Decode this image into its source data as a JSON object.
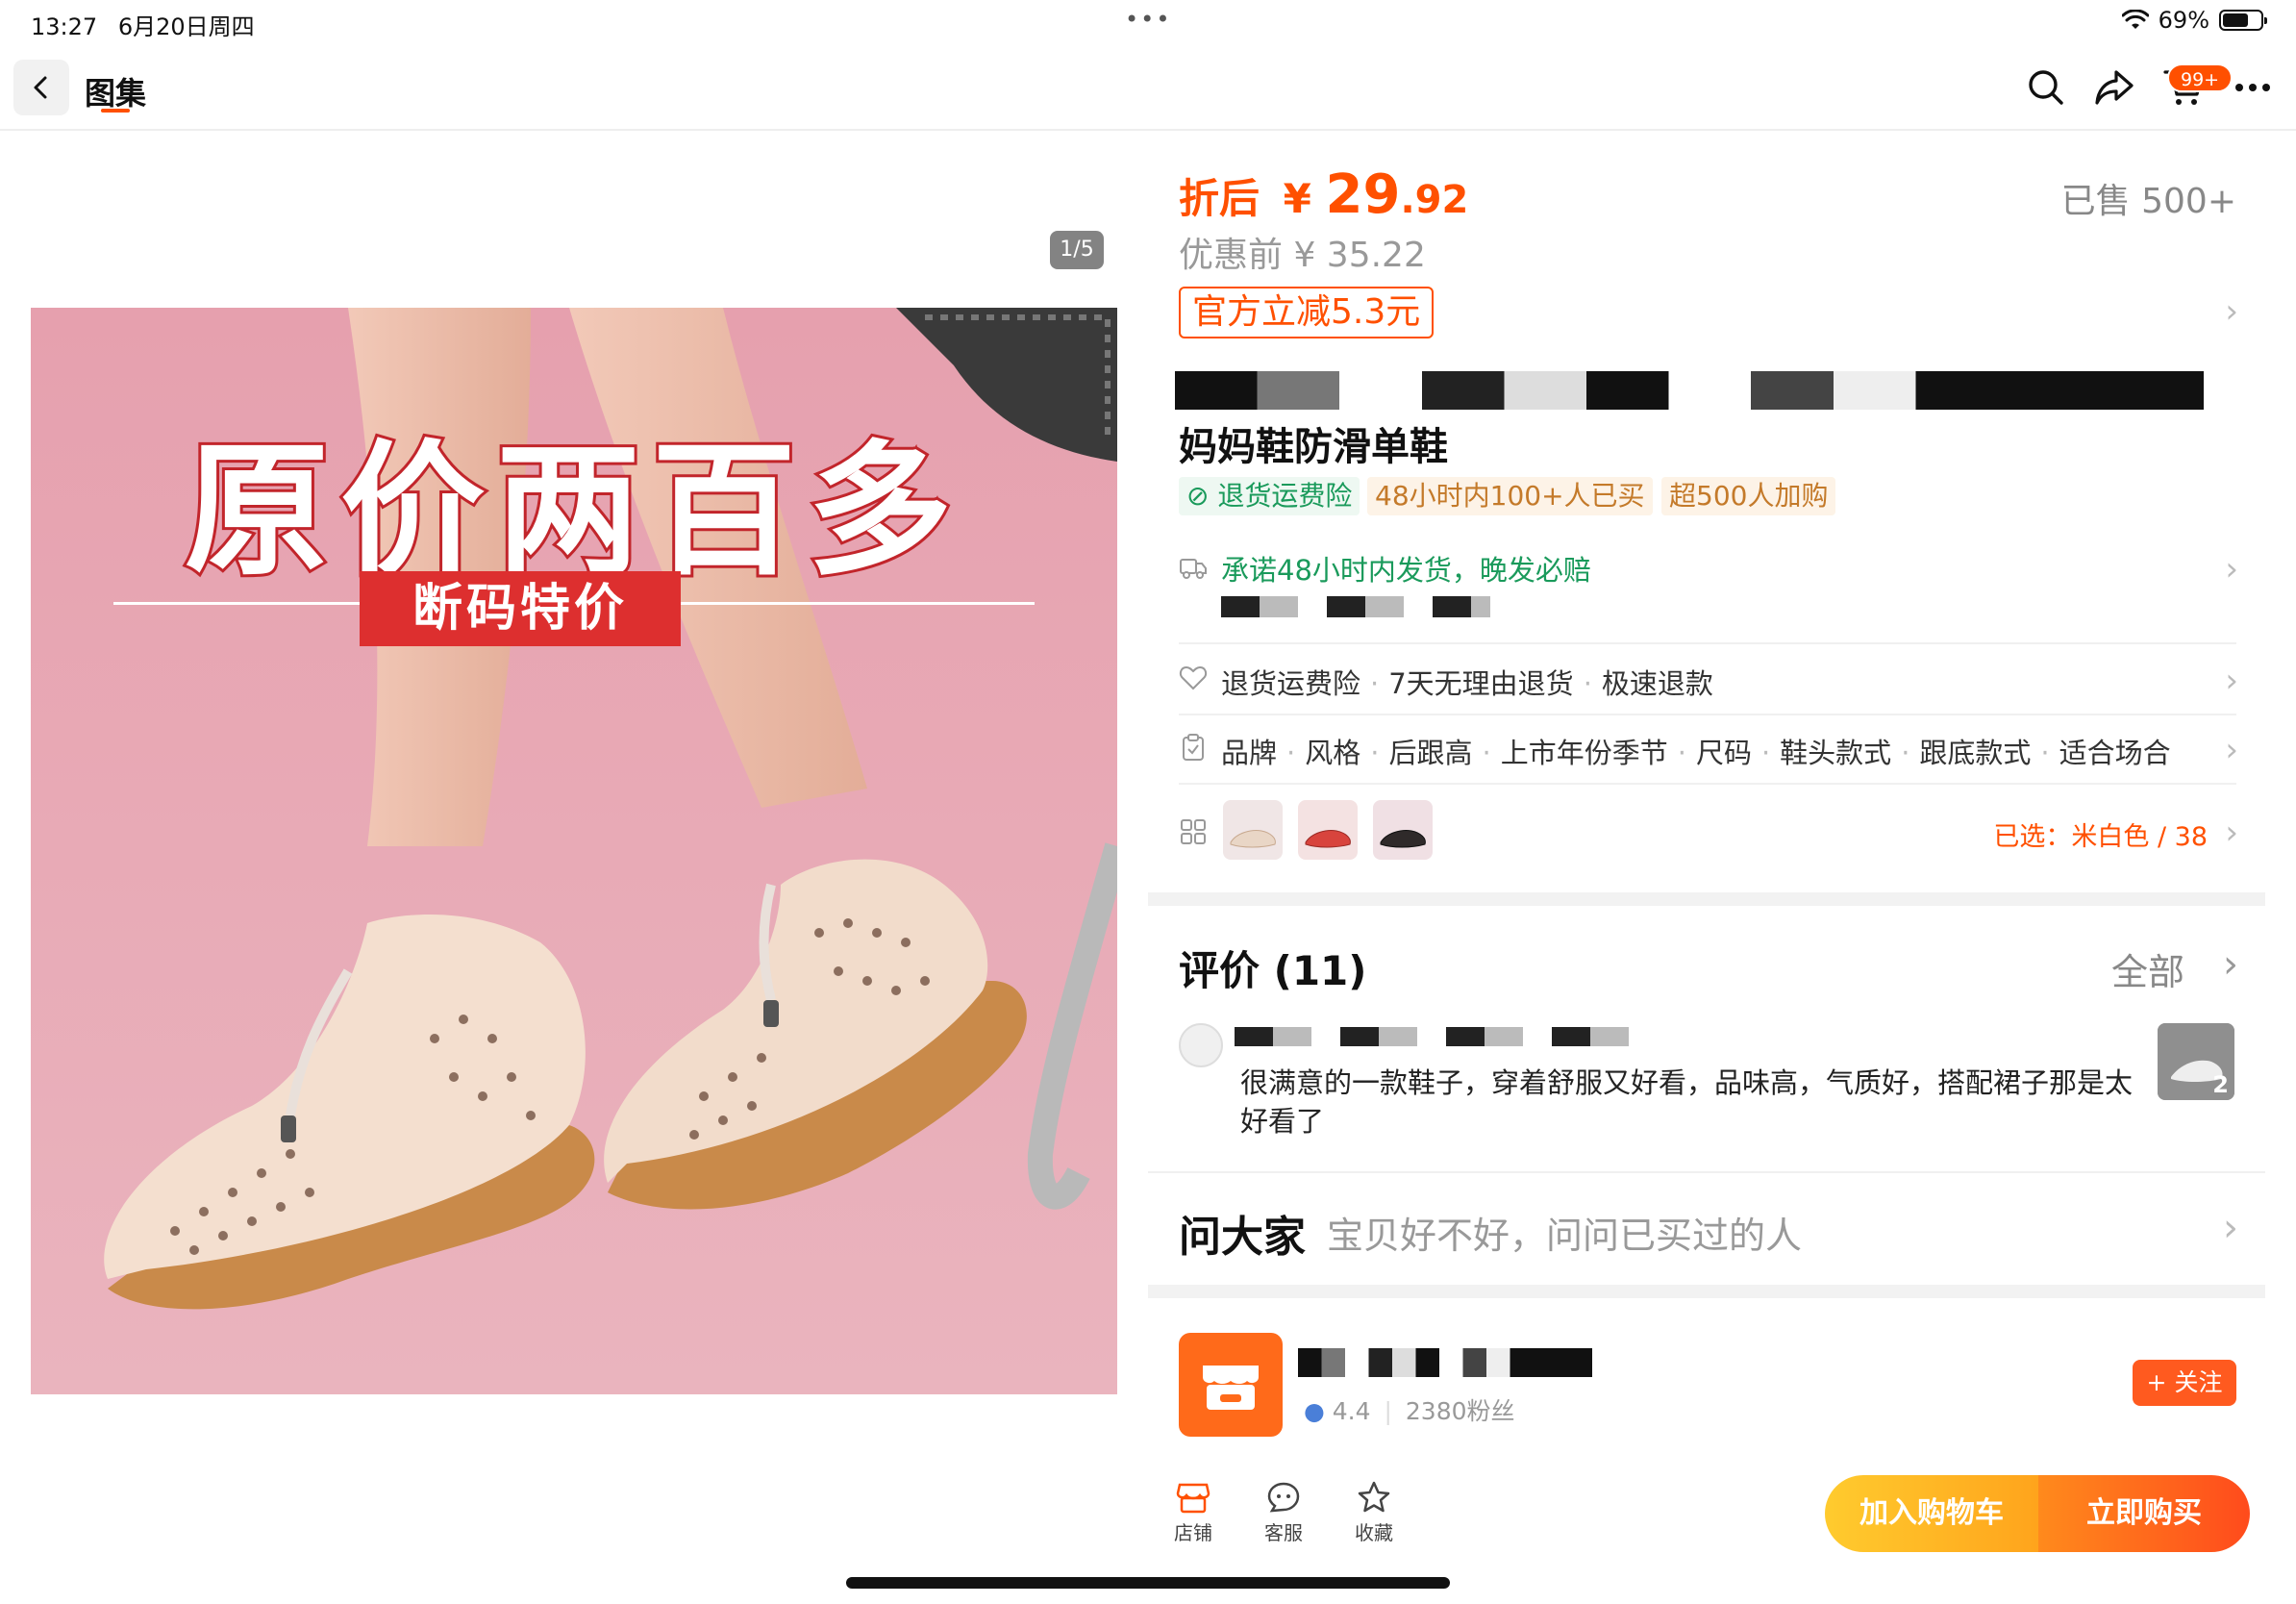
{
  "status_bar": {
    "time": "13:27",
    "date": "6月20日周四",
    "dots": "•••",
    "battery_percent": "69%",
    "battery_level": 0.69
  },
  "nav": {
    "title": "图集",
    "cart_badge": "99+",
    "icons": [
      "back-icon",
      "search-icon",
      "share-icon",
      "cart-icon",
      "more-icon"
    ]
  },
  "gallery": {
    "counter": "1/5",
    "headline": "原价两百多",
    "banner": "断码特价"
  },
  "price": {
    "label": "折后",
    "currency": "¥",
    "integer": "29",
    "decimal": ".92",
    "sold": "已售 500+",
    "original": "优惠前 ¥ 35.22",
    "discount_tag": "官方立减5.3元"
  },
  "product": {
    "title": "妈妈鞋防滑单鞋",
    "tags": [
      "退货运费险",
      "48小时内100+人已买",
      "超500人加购"
    ]
  },
  "shipping": {
    "promise": "承诺48小时内发货，晚发必赔"
  },
  "service": {
    "items": [
      "退货运费险",
      "7天无理由退货",
      "极速退款"
    ]
  },
  "params": {
    "items": [
      "品牌",
      "风格",
      "后跟高",
      "上市年份季节",
      "尺码",
      "鞋头款式",
      "跟底款式",
      "适合场合"
    ]
  },
  "sku": {
    "selected": "已选：米白色 / 38",
    "thumb_colors": [
      "#e9d6c6",
      "#d8443d",
      "#2f2a2a"
    ]
  },
  "reviews": {
    "title": "评价 (11)",
    "all_label": "全部",
    "text": "很满意的一款鞋子，穿着舒服又好看，品味高，气质好，搭配裙子那是太好看了",
    "photo_count": "2"
  },
  "ask": {
    "title": "问大家",
    "subtitle": "宝贝好不好，问问已买过的人"
  },
  "shop": {
    "rating": "4.4",
    "fans": "2380粉丝",
    "follow_label": "+ 关注"
  },
  "bottom_bar": {
    "store_label": "店铺",
    "service_label": "客服",
    "favorite_label": "收藏",
    "add_cart_label": "加入购物车",
    "buy_now_label": "立即购买"
  },
  "colors": {
    "accent": "#ff5000",
    "green": "#1a9a5b",
    "tag_orange": "#c47a2a"
  }
}
